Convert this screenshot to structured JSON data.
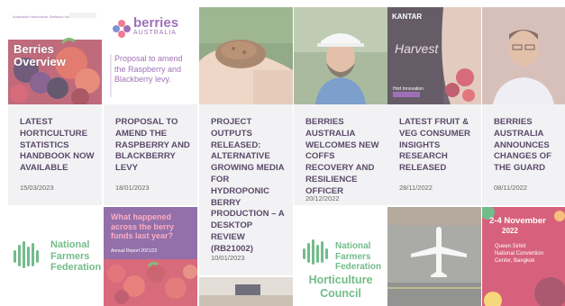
{
  "news_cards": [
    {
      "title": "LATEST HORTICULTURE STATISTICS HANDBOOK NOW AVAILABLE",
      "date": "15/03/2023",
      "thumb_heading": "Australian Horticulture Statistics Handbook",
      "thumb_title": "Berries Overview"
    },
    {
      "title": "PROPOSAL TO AMEND THE RASPBERRY AND BLACKBERRY LEVY",
      "date": "18/01/2023",
      "thumb_brand_top": "berries",
      "thumb_brand_bottom": "AUSTRALIA",
      "thumb_title": "Proposal to amend the Raspberry and Blackberry levy."
    },
    {
      "title": "PROJECT OUTPUTS RELEASED: ALTERNATIVE GROWING MEDIA FOR HYDROPONIC BERRY PRODUCTION – A DESKTOP REVIEW (RB21002)",
      "date": "10/01/2023"
    },
    {
      "title": "BERRIES AUSTRALIA WELCOMES NEW COFFS RECOVERY AND RESILIENCE OFFICER",
      "date": "20/12/2022"
    },
    {
      "title": "LATEST FRUIT & VEG CONSUMER INSIGHTS RESEARCH RELEASED",
      "date": "28/11/2022",
      "thumb_brand": "KANTAR",
      "thumb_cover": "Harvest",
      "thumb_footer": "Hort Innovation"
    },
    {
      "title": "BERRIES AUSTRALIA ANNOUNCES CHANGES OF THE GUARD",
      "date": "08/11/2022"
    }
  ],
  "bottom_cards": [
    {
      "logo_line1": "National",
      "logo_line2": "Farmers",
      "logo_line3": "Federation"
    },
    {
      "headline_line1": "What happened",
      "headline_line2": "across the berry",
      "headline_line3": "funds last year?",
      "subtitle": "Annual Report 2021/22"
    },
    {},
    {
      "logo_line1": "National",
      "logo_line2": "Farmers",
      "logo_line3": "Federation",
      "council_line1": "Horticulture",
      "council_line2": "Council"
    },
    {},
    {
      "event_dates": "2-4 November",
      "event_year": "2022",
      "event_venue_1": "Queen Sirikit",
      "event_venue_2": "National Convention",
      "event_venue_3": "Center, Bangkok"
    }
  ],
  "colors": {
    "headline": "#5a4a6a",
    "card_bg": "#f2f2f4",
    "brand_green": "#3da35d",
    "brand_purple": "#7a4a9a"
  }
}
